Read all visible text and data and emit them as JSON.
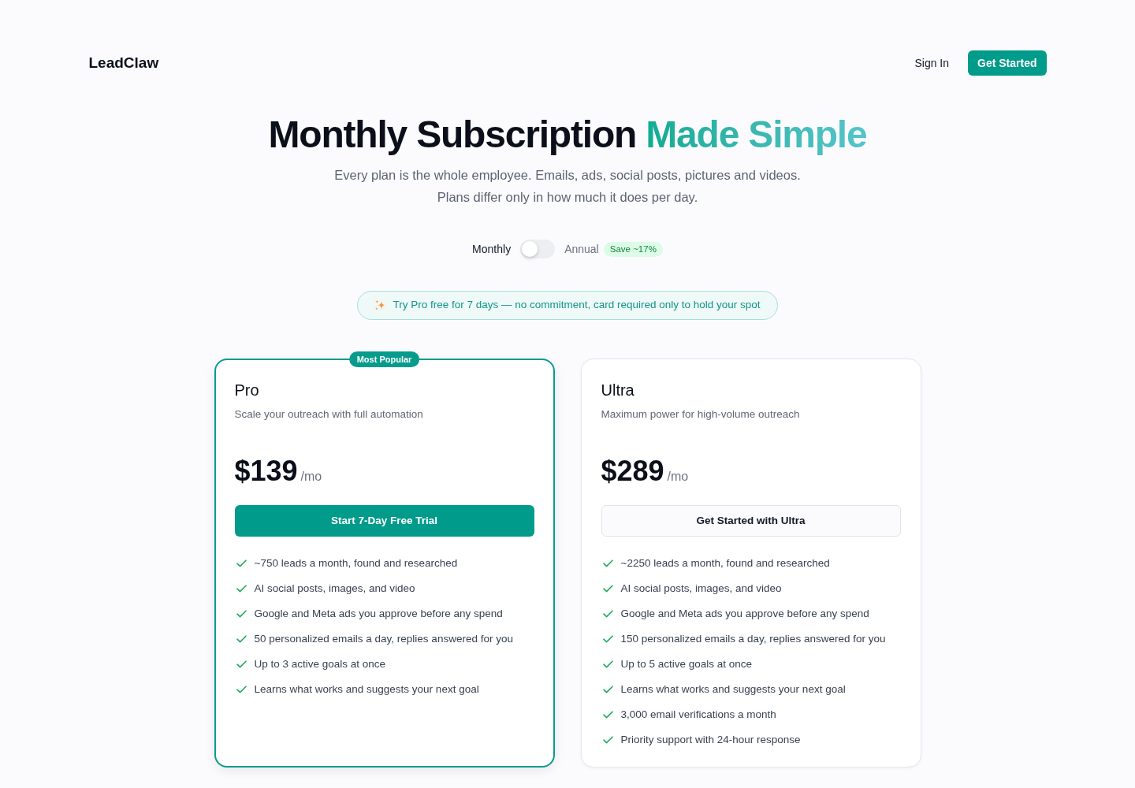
{
  "header": {
    "logo": "LeadClaw",
    "sign_in": "Sign In",
    "cta": "Get Started"
  },
  "hero": {
    "title": "Monthly Subscription",
    "title_highlight": "Made Simple",
    "subtitle_lines": [
      "Every plan is the whole employee. Emails, ads, social posts, pictures and videos.",
      "Plans differ only in how much it does per day."
    ]
  },
  "billing_toggle": {
    "left_label": "Monthly",
    "right_label": "Annual",
    "on": false,
    "badge": "Save ~17%"
  },
  "trial_banner": {
    "text": "Try Pro free for 7 days — no commitment, card required only to hold your spot"
  },
  "plans": [
    {
      "name": "Pro",
      "featured": true,
      "badge": "Most Popular",
      "description": "Scale your outreach with full automation",
      "price": "$139",
      "period": "/mo",
      "button": "Start 7-Day Free Trial",
      "features": [
        "~750 leads a month, found and researched",
        "AI social posts, images, and video",
        "Google and Meta ads you approve before any spend",
        "50 personalized emails a day, replies answered for you",
        "Up to 3 active goals at once",
        "Learns what works and suggests your next goal"
      ]
    },
    {
      "name": "Ultra",
      "featured": false,
      "description": "Maximum power for high-volume outreach",
      "price": "$289",
      "period": "/mo",
      "button": "Get Started with Ultra",
      "features": [
        "~2250 leads a month, found and researched",
        "AI social posts, images, and video",
        "Google and Meta ads you approve before any spend",
        "150 personalized emails a day, replies answered for you",
        "Up to 5 active goals at once",
        "Learns what works and suggests your next goal",
        "3,000 email verifications a month",
        "Priority support with 24-hour response"
      ]
    }
  ]
}
